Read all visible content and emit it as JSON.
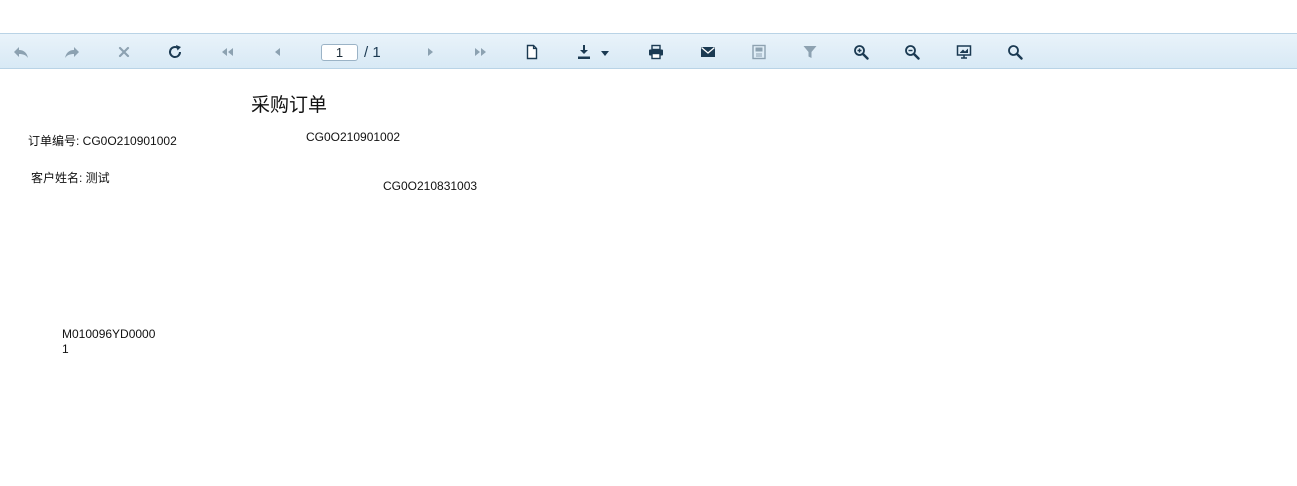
{
  "toolbar": {
    "current_page": "1",
    "page_total": "/ 1",
    "icons": [
      "undo-icon",
      "redo-icon",
      "stop-icon",
      "refresh-icon",
      "first-page-icon",
      "prev-page-icon",
      "next-page-icon",
      "last-page-icon",
      "document-icon",
      "export-icon",
      "print-icon",
      "email-icon",
      "save-icon",
      "filter-icon",
      "zoom-in-icon",
      "zoom-out-icon",
      "fullscreen-icon",
      "search-icon"
    ],
    "icon_color": "#1b3a52",
    "bar_color": "#dcebf6"
  },
  "report": {
    "title": "采购订单",
    "order_no_label": "订单编号: CG0O210901002",
    "order_no_value": "CG0O210901002",
    "customer_label": "客户姓名: 测试",
    "related_order": "CG0O210831003",
    "material_code_line1": "M010096YD0000",
    "material_code_line2": "1"
  }
}
